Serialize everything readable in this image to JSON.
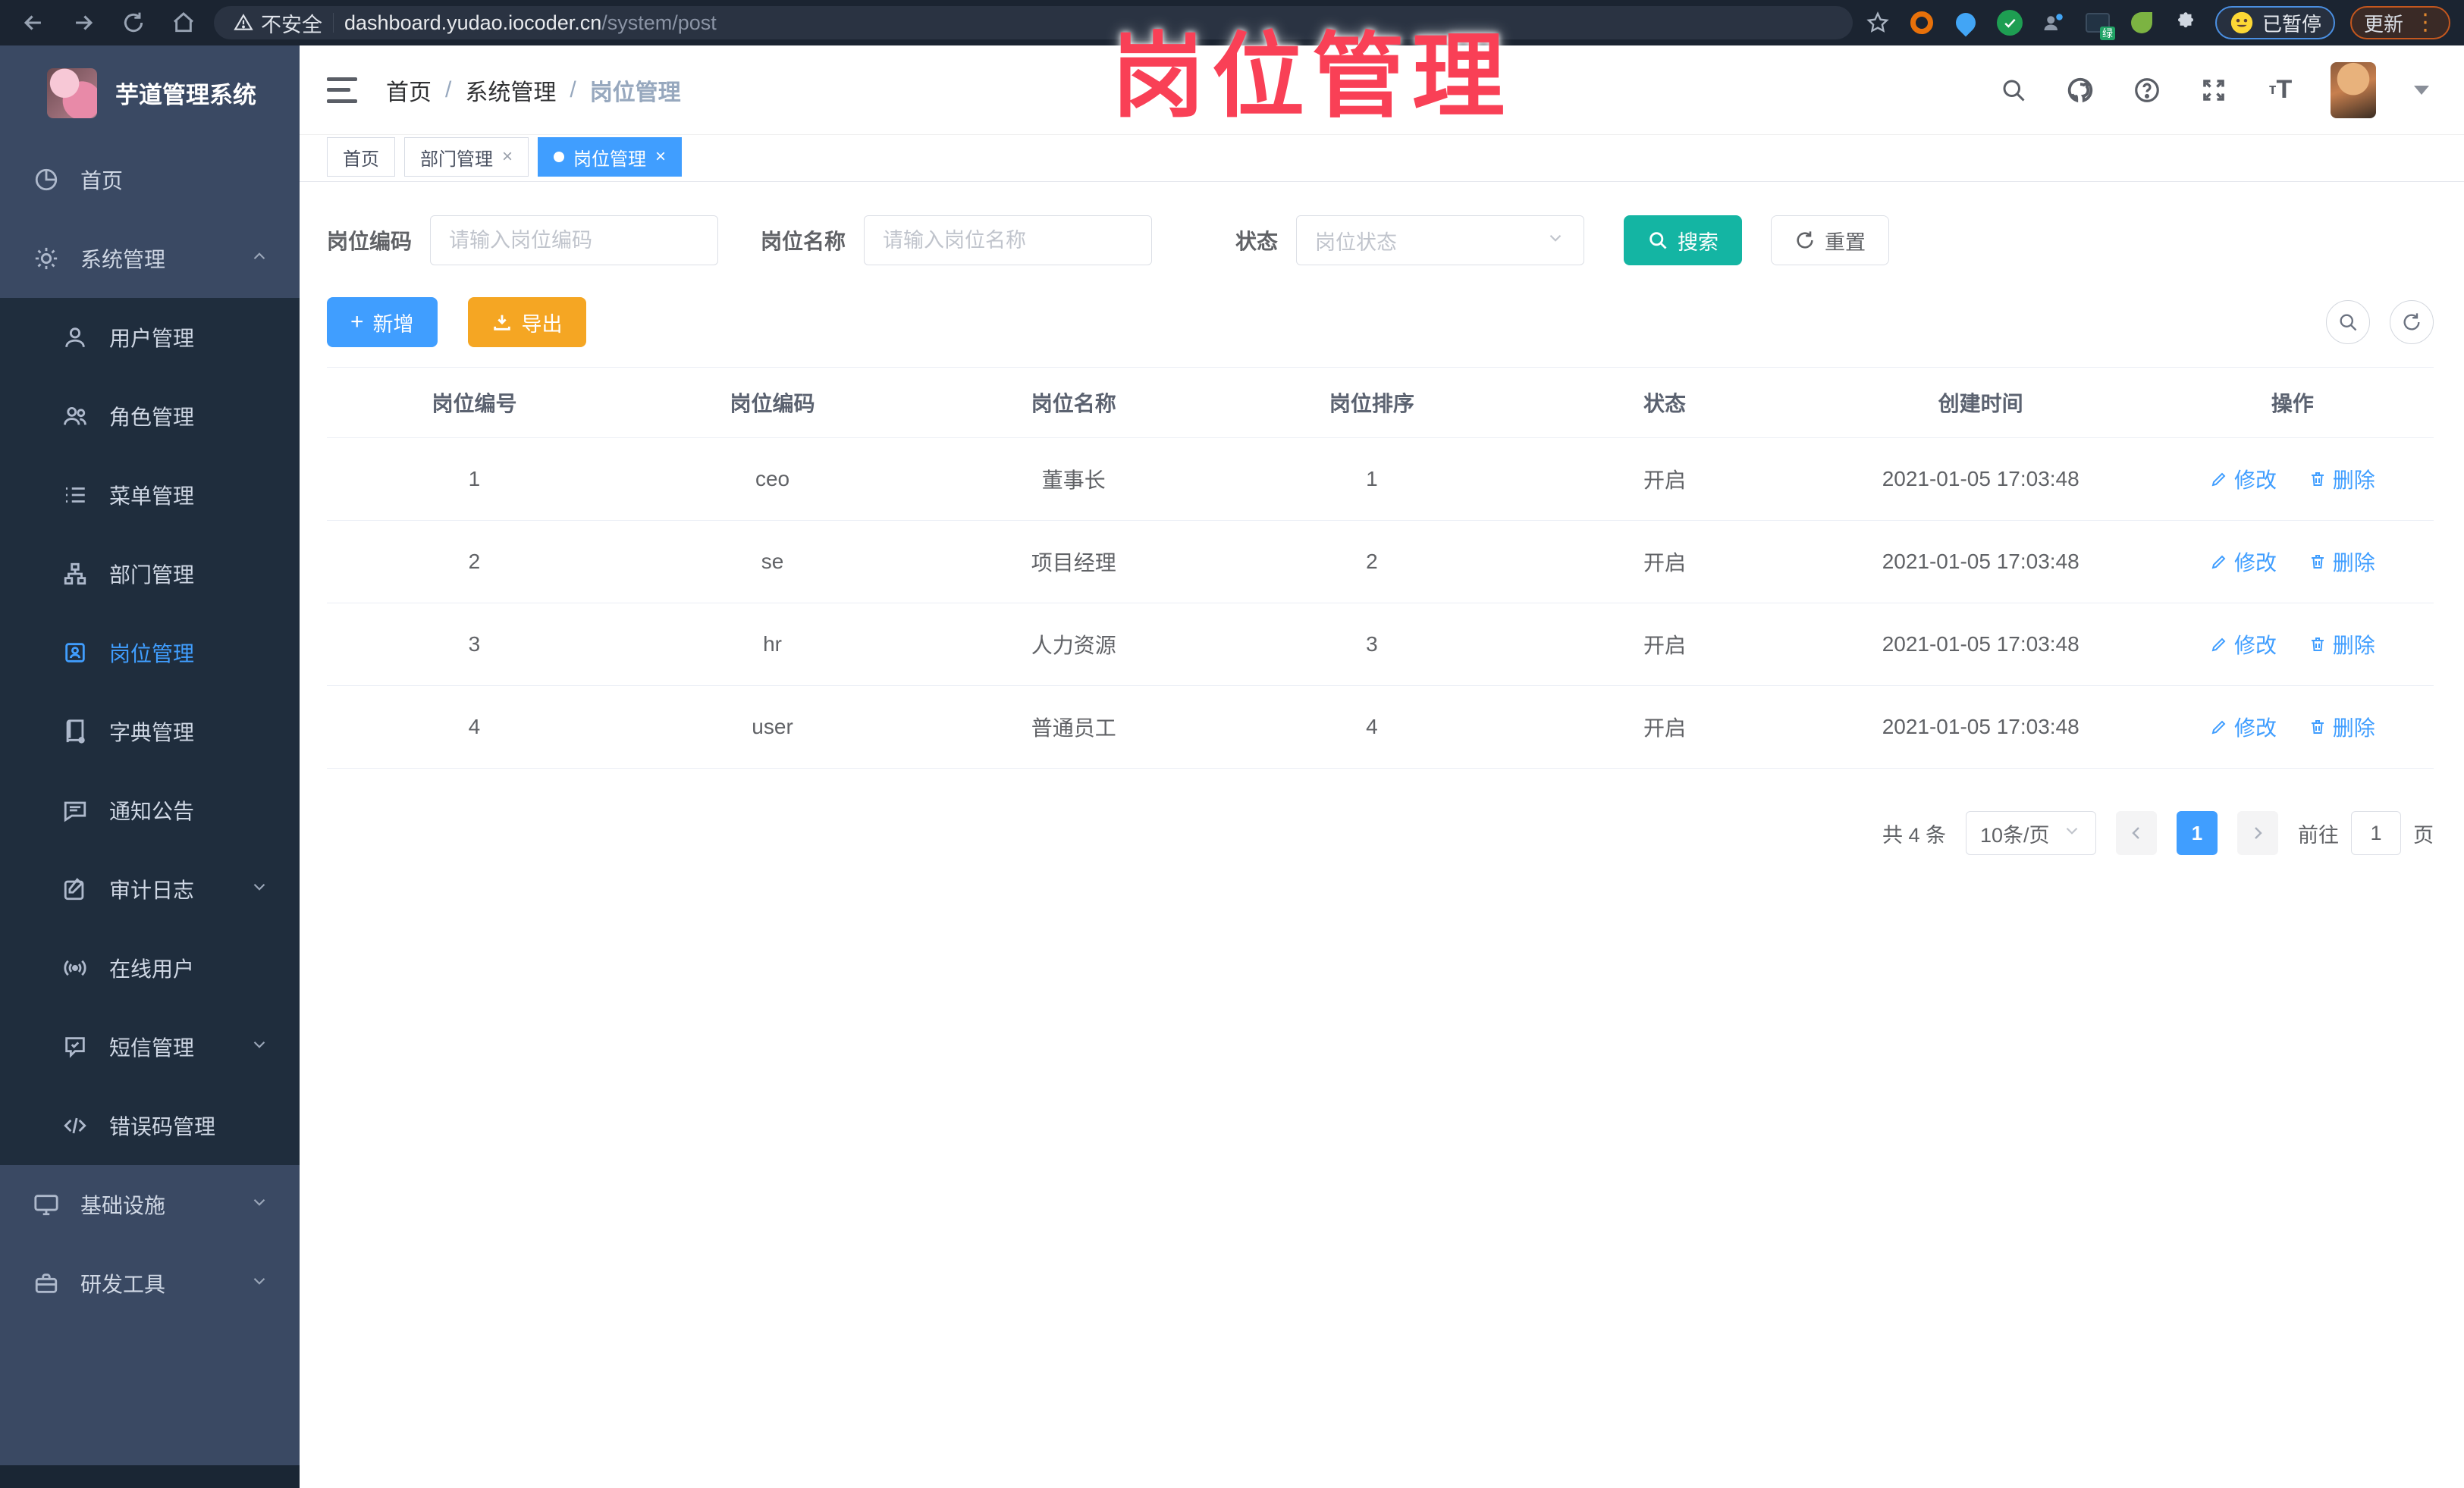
{
  "browser": {
    "security_label": "不安全",
    "url_domain": "dashboard.yudao.iocoder.cn",
    "url_path": "/system/post",
    "paused_badge": "已暂停",
    "update_button": "更新"
  },
  "watermark": "岗位管理",
  "sidebar": {
    "title": "芋道管理系统",
    "items": [
      {
        "label": "首页"
      },
      {
        "label": "系统管理"
      },
      {
        "label": "用户管理"
      },
      {
        "label": "角色管理"
      },
      {
        "label": "菜单管理"
      },
      {
        "label": "部门管理"
      },
      {
        "label": "岗位管理"
      },
      {
        "label": "字典管理"
      },
      {
        "label": "通知公告"
      },
      {
        "label": "审计日志"
      },
      {
        "label": "在线用户"
      },
      {
        "label": "短信管理"
      },
      {
        "label": "错误码管理"
      },
      {
        "label": "基础设施"
      },
      {
        "label": "研发工具"
      }
    ]
  },
  "breadcrumb": {
    "home": "首页",
    "section": "系统管理",
    "current": "岗位管理"
  },
  "tabs": [
    {
      "label": "首页"
    },
    {
      "label": "部门管理"
    },
    {
      "label": "岗位管理"
    }
  ],
  "filters": {
    "code_label": "岗位编码",
    "code_placeholder": "请输入岗位编码",
    "name_label": "岗位名称",
    "name_placeholder": "请输入岗位名称",
    "status_label": "状态",
    "status_placeholder": "岗位状态",
    "search_label": "搜索",
    "reset_label": "重置"
  },
  "actions": {
    "add_label": "新增",
    "export_label": "导出"
  },
  "table": {
    "columns": [
      "岗位编号",
      "岗位编码",
      "岗位名称",
      "岗位排序",
      "状态",
      "创建时间",
      "操作"
    ],
    "edit_label": "修改",
    "delete_label": "删除",
    "rows": [
      {
        "id": "1",
        "code": "ceo",
        "name": "董事长",
        "sort": "1",
        "status": "开启",
        "created": "2021-01-05 17:03:48"
      },
      {
        "id": "2",
        "code": "se",
        "name": "项目经理",
        "sort": "2",
        "status": "开启",
        "created": "2021-01-05 17:03:48"
      },
      {
        "id": "3",
        "code": "hr",
        "name": "人力资源",
        "sort": "3",
        "status": "开启",
        "created": "2021-01-05 17:03:48"
      },
      {
        "id": "4",
        "code": "user",
        "name": "普通员工",
        "sort": "4",
        "status": "开启",
        "created": "2021-01-05 17:03:48"
      }
    ]
  },
  "pagination": {
    "total_text": "共 4 条",
    "page_size": "10条/页",
    "current_page": "1",
    "goto_label": "前往",
    "goto_value": "1",
    "page_unit": "页"
  },
  "colors": {
    "accent_blue": "#409eff",
    "search_teal": "#14b5a3",
    "export_orange": "#f5a623",
    "watermark_pink": "#f94056",
    "sidebar_dark": "#1f2d3d",
    "sidebar_light": "#3a4963"
  }
}
